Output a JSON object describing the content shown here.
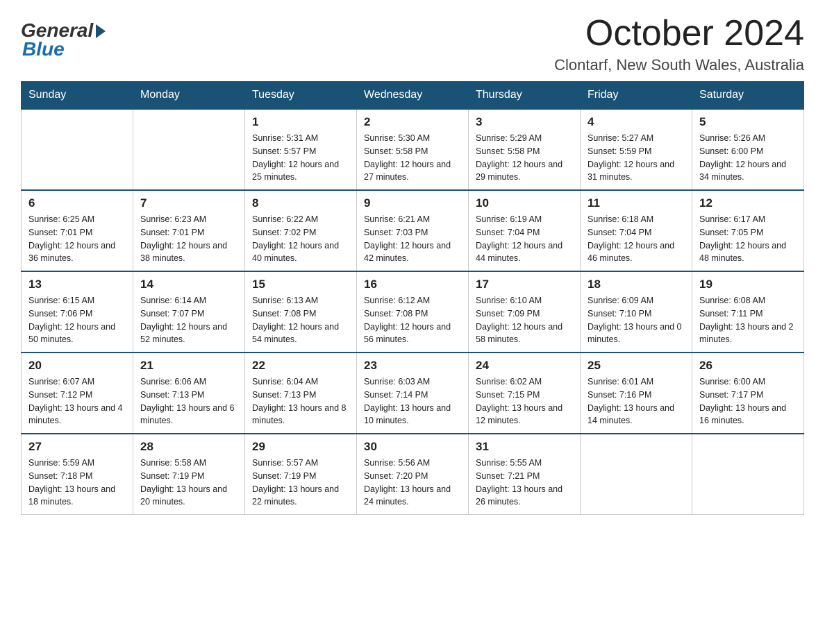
{
  "header": {
    "logo_general": "General",
    "logo_blue": "Blue",
    "month_title": "October 2024",
    "location": "Clontarf, New South Wales, Australia"
  },
  "weekdays": [
    "Sunday",
    "Monday",
    "Tuesday",
    "Wednesday",
    "Thursday",
    "Friday",
    "Saturday"
  ],
  "weeks": [
    [
      {
        "day": "",
        "sunrise": "",
        "sunset": "",
        "daylight": ""
      },
      {
        "day": "",
        "sunrise": "",
        "sunset": "",
        "daylight": ""
      },
      {
        "day": "1",
        "sunrise": "Sunrise: 5:31 AM",
        "sunset": "Sunset: 5:57 PM",
        "daylight": "Daylight: 12 hours and 25 minutes."
      },
      {
        "day": "2",
        "sunrise": "Sunrise: 5:30 AM",
        "sunset": "Sunset: 5:58 PM",
        "daylight": "Daylight: 12 hours and 27 minutes."
      },
      {
        "day": "3",
        "sunrise": "Sunrise: 5:29 AM",
        "sunset": "Sunset: 5:58 PM",
        "daylight": "Daylight: 12 hours and 29 minutes."
      },
      {
        "day": "4",
        "sunrise": "Sunrise: 5:27 AM",
        "sunset": "Sunset: 5:59 PM",
        "daylight": "Daylight: 12 hours and 31 minutes."
      },
      {
        "day": "5",
        "sunrise": "Sunrise: 5:26 AM",
        "sunset": "Sunset: 6:00 PM",
        "daylight": "Daylight: 12 hours and 34 minutes."
      }
    ],
    [
      {
        "day": "6",
        "sunrise": "Sunrise: 6:25 AM",
        "sunset": "Sunset: 7:01 PM",
        "daylight": "Daylight: 12 hours and 36 minutes."
      },
      {
        "day": "7",
        "sunrise": "Sunrise: 6:23 AM",
        "sunset": "Sunset: 7:01 PM",
        "daylight": "Daylight: 12 hours and 38 minutes."
      },
      {
        "day": "8",
        "sunrise": "Sunrise: 6:22 AM",
        "sunset": "Sunset: 7:02 PM",
        "daylight": "Daylight: 12 hours and 40 minutes."
      },
      {
        "day": "9",
        "sunrise": "Sunrise: 6:21 AM",
        "sunset": "Sunset: 7:03 PM",
        "daylight": "Daylight: 12 hours and 42 minutes."
      },
      {
        "day": "10",
        "sunrise": "Sunrise: 6:19 AM",
        "sunset": "Sunset: 7:04 PM",
        "daylight": "Daylight: 12 hours and 44 minutes."
      },
      {
        "day": "11",
        "sunrise": "Sunrise: 6:18 AM",
        "sunset": "Sunset: 7:04 PM",
        "daylight": "Daylight: 12 hours and 46 minutes."
      },
      {
        "day": "12",
        "sunrise": "Sunrise: 6:17 AM",
        "sunset": "Sunset: 7:05 PM",
        "daylight": "Daylight: 12 hours and 48 minutes."
      }
    ],
    [
      {
        "day": "13",
        "sunrise": "Sunrise: 6:15 AM",
        "sunset": "Sunset: 7:06 PM",
        "daylight": "Daylight: 12 hours and 50 minutes."
      },
      {
        "day": "14",
        "sunrise": "Sunrise: 6:14 AM",
        "sunset": "Sunset: 7:07 PM",
        "daylight": "Daylight: 12 hours and 52 minutes."
      },
      {
        "day": "15",
        "sunrise": "Sunrise: 6:13 AM",
        "sunset": "Sunset: 7:08 PM",
        "daylight": "Daylight: 12 hours and 54 minutes."
      },
      {
        "day": "16",
        "sunrise": "Sunrise: 6:12 AM",
        "sunset": "Sunset: 7:08 PM",
        "daylight": "Daylight: 12 hours and 56 minutes."
      },
      {
        "day": "17",
        "sunrise": "Sunrise: 6:10 AM",
        "sunset": "Sunset: 7:09 PM",
        "daylight": "Daylight: 12 hours and 58 minutes."
      },
      {
        "day": "18",
        "sunrise": "Sunrise: 6:09 AM",
        "sunset": "Sunset: 7:10 PM",
        "daylight": "Daylight: 13 hours and 0 minutes."
      },
      {
        "day": "19",
        "sunrise": "Sunrise: 6:08 AM",
        "sunset": "Sunset: 7:11 PM",
        "daylight": "Daylight: 13 hours and 2 minutes."
      }
    ],
    [
      {
        "day": "20",
        "sunrise": "Sunrise: 6:07 AM",
        "sunset": "Sunset: 7:12 PM",
        "daylight": "Daylight: 13 hours and 4 minutes."
      },
      {
        "day": "21",
        "sunrise": "Sunrise: 6:06 AM",
        "sunset": "Sunset: 7:13 PM",
        "daylight": "Daylight: 13 hours and 6 minutes."
      },
      {
        "day": "22",
        "sunrise": "Sunrise: 6:04 AM",
        "sunset": "Sunset: 7:13 PM",
        "daylight": "Daylight: 13 hours and 8 minutes."
      },
      {
        "day": "23",
        "sunrise": "Sunrise: 6:03 AM",
        "sunset": "Sunset: 7:14 PM",
        "daylight": "Daylight: 13 hours and 10 minutes."
      },
      {
        "day": "24",
        "sunrise": "Sunrise: 6:02 AM",
        "sunset": "Sunset: 7:15 PM",
        "daylight": "Daylight: 13 hours and 12 minutes."
      },
      {
        "day": "25",
        "sunrise": "Sunrise: 6:01 AM",
        "sunset": "Sunset: 7:16 PM",
        "daylight": "Daylight: 13 hours and 14 minutes."
      },
      {
        "day": "26",
        "sunrise": "Sunrise: 6:00 AM",
        "sunset": "Sunset: 7:17 PM",
        "daylight": "Daylight: 13 hours and 16 minutes."
      }
    ],
    [
      {
        "day": "27",
        "sunrise": "Sunrise: 5:59 AM",
        "sunset": "Sunset: 7:18 PM",
        "daylight": "Daylight: 13 hours and 18 minutes."
      },
      {
        "day": "28",
        "sunrise": "Sunrise: 5:58 AM",
        "sunset": "Sunset: 7:19 PM",
        "daylight": "Daylight: 13 hours and 20 minutes."
      },
      {
        "day": "29",
        "sunrise": "Sunrise: 5:57 AM",
        "sunset": "Sunset: 7:19 PM",
        "daylight": "Daylight: 13 hours and 22 minutes."
      },
      {
        "day": "30",
        "sunrise": "Sunrise: 5:56 AM",
        "sunset": "Sunset: 7:20 PM",
        "daylight": "Daylight: 13 hours and 24 minutes."
      },
      {
        "day": "31",
        "sunrise": "Sunrise: 5:55 AM",
        "sunset": "Sunset: 7:21 PM",
        "daylight": "Daylight: 13 hours and 26 minutes."
      },
      {
        "day": "",
        "sunrise": "",
        "sunset": "",
        "daylight": ""
      },
      {
        "day": "",
        "sunrise": "",
        "sunset": "",
        "daylight": ""
      }
    ]
  ]
}
